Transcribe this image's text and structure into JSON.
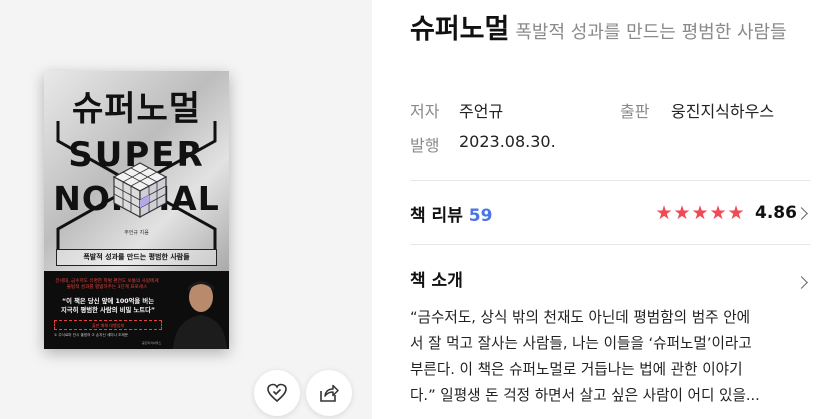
{
  "cover": {
    "title": "슈퍼노멀",
    "title_en_1": "SUPER",
    "title_en_2": "NORMAL",
    "author": "주언규 지음",
    "tagline": "폭발적 성과를 만드는 평범한 사람들",
    "red_copy_1": "전세대, 금수저도 유명한 학벌 편전도 보통의 사람에게",
    "red_copy_2": "불법적 성과를 평범하주는 3단계 프로세스",
    "quote_1": "“이 책은 당신 앞에 100억을 버는",
    "quote_2": "지극히 평범한 사람의 비밀 노트다”",
    "dash_text": "출판 매체 대행업체",
    "ref_text": "① 주식로마 안시 출범의 ② 손자신 세미나 조제문",
    "publisher_mark": "웅진지식하우스"
  },
  "actions": {
    "wishlist_icon": "heart-check-icon",
    "share_icon": "share-icon"
  },
  "book": {
    "title": "슈퍼노멀",
    "subtitle": "폭발적 성과를 만드는 평범한 사람들",
    "author_label": "저자",
    "author": "주언규",
    "publisher_label": "출판",
    "publisher": "웅진지식하우스",
    "date_label": "발행",
    "date": "2023.08.30."
  },
  "review": {
    "label": "책 리뷰",
    "count": "59",
    "stars": [
      "★",
      "★",
      "★",
      "★",
      "★"
    ],
    "rating": "4.86"
  },
  "intro": {
    "label": "책 소개",
    "lines": [
      "“금수저도, 상식 밖의 천재도 아닌데 평범함의 범주 안에",
      "서 잘 먹고 잘사는 사람들, 나는 이들을 ‘슈퍼노멀’이라고",
      "부른다. 이 책은 슈퍼노멀로 거듭나는 법에 관한 이야기",
      "다.” 일평생 돈 걱정 하면서 살고 싶은 사람이 어디 있을..."
    ]
  },
  "colors": {
    "accent_red": "#ef4a55",
    "count_blue": "#4b74e5",
    "muted_gray": "#8a8a8a",
    "panel_bg": "#f4f4f4"
  }
}
